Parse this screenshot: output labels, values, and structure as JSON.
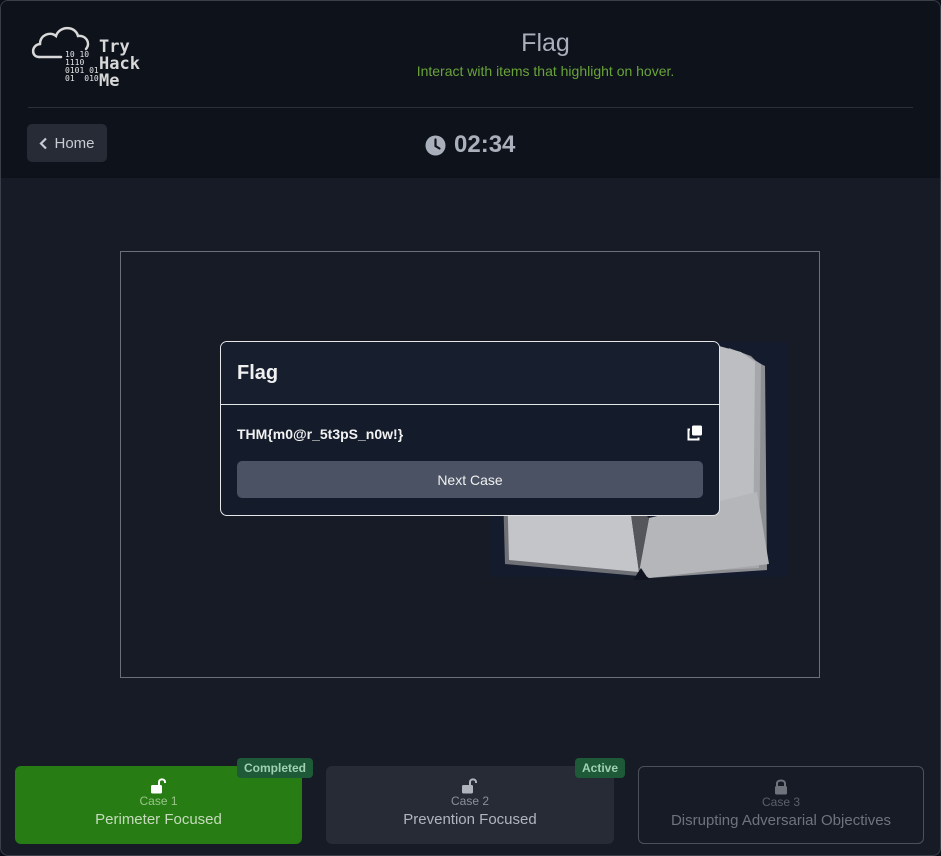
{
  "logo": {
    "bits": "10 10\n1110\n0101 01\n01  010",
    "line1": "Try",
    "line2": "Hack",
    "line3": "Me"
  },
  "header": {
    "title": "Flag",
    "subtitle": "Interact with items that highlight on hover.",
    "home_label": "Home",
    "timer": "02:34"
  },
  "modal": {
    "title": "Flag",
    "flag": "THM{m0@r_5t3pS_n0w!}",
    "next_label": "Next Case"
  },
  "cases": [
    {
      "number": "Case 1",
      "name": "Perimeter Focused",
      "badge": "Completed",
      "state": "completed",
      "icon": "unlock-icon"
    },
    {
      "number": "Case 2",
      "name": "Prevention Focused",
      "badge": "Active",
      "state": "active",
      "icon": "unlock-icon"
    },
    {
      "number": "Case 3",
      "name": "Disrupting Adversarial Objectives",
      "state": "locked",
      "icon": "lock-icon"
    }
  ],
  "colors": {
    "completed": "#277d13",
    "active_badge": "#1f5a38",
    "subtitle": "#6aa33a"
  }
}
